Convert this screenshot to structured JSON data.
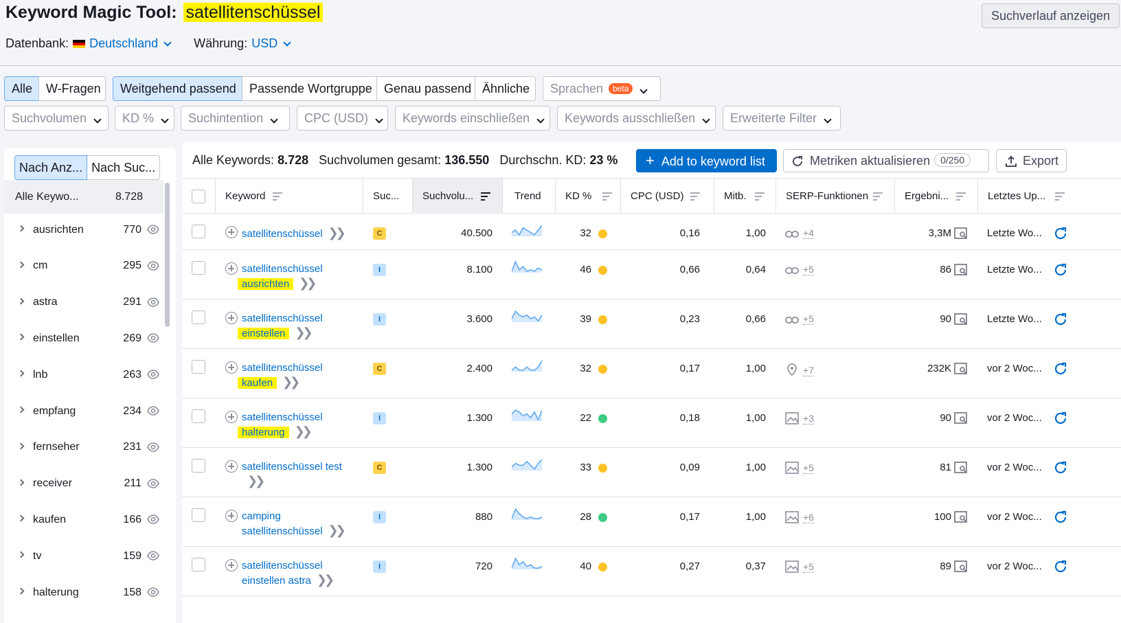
{
  "header": {
    "title": "Keyword Magic Tool:",
    "query": "satellitenschüssel",
    "history_button": "Suchverlauf anzeigen",
    "db_label": "Datenbank:",
    "db_value": "Deutschland",
    "currency_label": "Währung:",
    "currency_value": "USD"
  },
  "match_tabs": [
    "Alle",
    "W-Fragen",
    "Weitgehend passend",
    "Passende Wortgruppe",
    "Genau passend",
    "Ähnliche"
  ],
  "languages": {
    "label": "Sprachen",
    "badge": "beta"
  },
  "filters": [
    "Suchvolumen",
    "KD %",
    "Suchintention",
    "CPC (USD)",
    "Keywords einschließen",
    "Keywords ausschließen",
    "Erweiterte Filter"
  ],
  "sidebar": {
    "tabs": [
      "Nach Anz...",
      "Nach Suc..."
    ],
    "all": {
      "label": "Alle Keywo...",
      "count": "8.728"
    },
    "groups": [
      {
        "label": "ausrichten",
        "count": "770"
      },
      {
        "label": "cm",
        "count": "295"
      },
      {
        "label": "astra",
        "count": "291"
      },
      {
        "label": "einstellen",
        "count": "269"
      },
      {
        "label": "lnb",
        "count": "263"
      },
      {
        "label": "empfang",
        "count": "234"
      },
      {
        "label": "fernseher",
        "count": "231"
      },
      {
        "label": "receiver",
        "count": "211"
      },
      {
        "label": "kaufen",
        "count": "166"
      },
      {
        "label": "tv",
        "count": "159"
      },
      {
        "label": "halterung",
        "count": "158"
      }
    ]
  },
  "stats": {
    "all_label": "Alle Keywords:",
    "all_value": "8.728",
    "vol_label": "Suchvolumen gesamt:",
    "vol_value": "136.550",
    "kd_label": "Durchschn. KD:",
    "kd_value": "23 %"
  },
  "actions": {
    "add": "Add to keyword list",
    "metrics": "Metriken aktualisieren",
    "metrics_count": "0/250",
    "export": "Export"
  },
  "columns": [
    "Keyword",
    "Suc...",
    "Suchvolu...",
    "Trend",
    "KD %",
    "CPC (USD)",
    "Mitb.",
    "SERP-Funktionen",
    "Ergebni...",
    "Letztes Up..."
  ],
  "colors": {
    "accent": "#006dca",
    "highlight": "#fff200",
    "kd_yellow": "#ffc123",
    "kd_green": "#3dcc85"
  },
  "rows": [
    {
      "kw1": "satellitenschüssel",
      "kw2": "",
      "hl": "",
      "intent": "C",
      "vol": "40.500",
      "trend": [
        6,
        7,
        5,
        8,
        7,
        6,
        5,
        7,
        9
      ],
      "kd": "32",
      "kdc": "yellow",
      "cpc": "0,16",
      "comp": "1,00",
      "serp_icon": "link-icon",
      "serp": "+4",
      "res": "3,3M",
      "last": "Letzte Wo..."
    },
    {
      "kw1": "satellitenschüssel",
      "kw2": "",
      "hl": "ausrichten",
      "intent": "I",
      "vol": "8.100",
      "trend": [
        3,
        9,
        4,
        6,
        3,
        4,
        3,
        5,
        4
      ],
      "kd": "46",
      "kdc": "yellow",
      "cpc": "0,66",
      "comp": "0,64",
      "serp_icon": "link-icon",
      "serp": "+5",
      "res": "86",
      "last": "Letzte Wo..."
    },
    {
      "kw1": "satellitenschüssel",
      "kw2": "",
      "hl": "einstellen",
      "intent": "I",
      "vol": "3.600",
      "trend": [
        4,
        8,
        6,
        5,
        6,
        4,
        5,
        3,
        6
      ],
      "kd": "39",
      "kdc": "yellow",
      "cpc": "0,23",
      "comp": "0,66",
      "serp_icon": "link-icon",
      "serp": "+5",
      "res": "90",
      "last": "Letzte Wo..."
    },
    {
      "kw1": "satellitenschüssel",
      "kw2": "",
      "hl": "kaufen",
      "intent": "C",
      "vol": "2.400",
      "trend": [
        6,
        7,
        6,
        6,
        7,
        6,
        6,
        7,
        9
      ],
      "kd": "32",
      "kdc": "yellow",
      "cpc": "0,17",
      "comp": "1,00",
      "serp_icon": "pin-icon",
      "serp": "+7",
      "res": "232K",
      "last": "vor 2 Woc..."
    },
    {
      "kw1": "satellitenschüssel",
      "kw2": "",
      "hl": "halterung",
      "intent": "I",
      "vol": "1.300",
      "trend": [
        6,
        8,
        7,
        5,
        6,
        4,
        7,
        3,
        8
      ],
      "kd": "22",
      "kdc": "green",
      "cpc": "0,18",
      "comp": "1,00",
      "serp_icon": "image-icon",
      "serp": "+3",
      "res": "90",
      "last": "vor 2 Woc..."
    },
    {
      "kw1": "satellitenschüssel test",
      "kw2": "",
      "hl": "",
      "intent": "C",
      "vol": "1.300",
      "trend": [
        5,
        7,
        6,
        6,
        8,
        6,
        4,
        7,
        9
      ],
      "kd": "33",
      "kdc": "yellow",
      "cpc": "0,09",
      "comp": "1,00",
      "serp_icon": "image-icon",
      "serp": "+5",
      "res": "81",
      "last": "vor 2 Woc..."
    },
    {
      "kw1": "camping",
      "kw2": "satellitenschüssel",
      "hl": "",
      "intent": "I",
      "vol": "880",
      "trend": [
        3,
        9,
        6,
        4,
        3,
        4,
        3,
        3,
        4
      ],
      "kd": "28",
      "kdc": "green",
      "cpc": "0,17",
      "comp": "1,00",
      "serp_icon": "image-icon",
      "serp": "+6",
      "res": "100",
      "last": "vor 2 Woc..."
    },
    {
      "kw1": "satellitenschüssel",
      "kw2": "einstellen astra",
      "hl": "",
      "intent": "I",
      "vol": "720",
      "trend": [
        3,
        9,
        5,
        7,
        4,
        5,
        3,
        3,
        4
      ],
      "kd": "40",
      "kdc": "yellow",
      "cpc": "0,27",
      "comp": "0,37",
      "serp_icon": "image-icon",
      "serp": "+5",
      "res": "89",
      "last": "vor 2 Woc..."
    }
  ]
}
